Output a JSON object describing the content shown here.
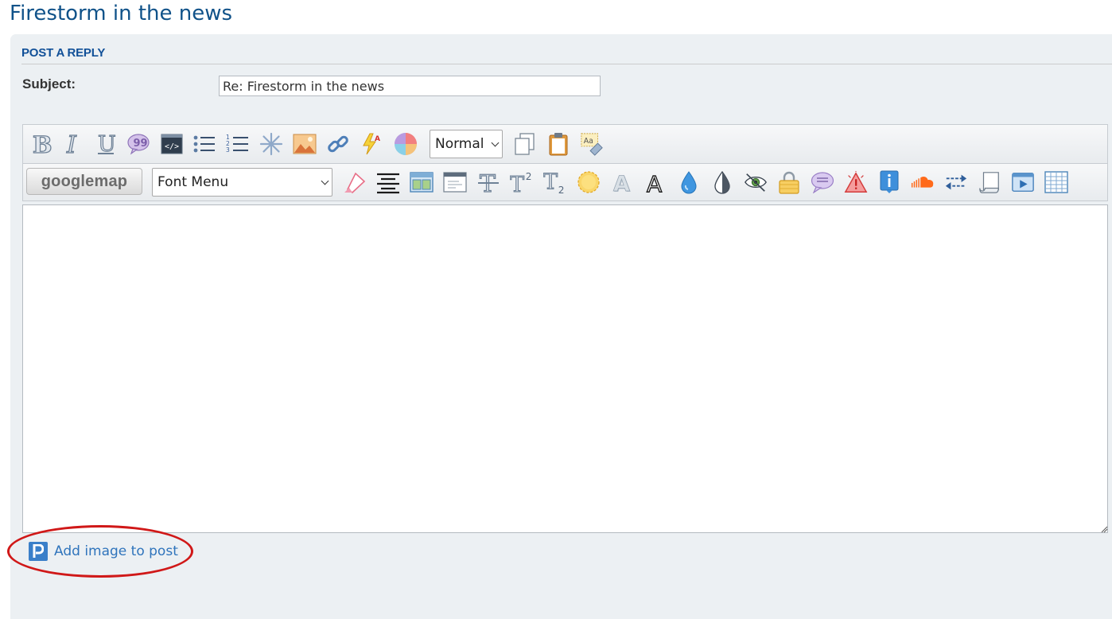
{
  "topic": {
    "title": "Firestorm in the news"
  },
  "reply": {
    "heading": "POST A REPLY",
    "subject_label": "Subject:",
    "subject_value": "Re: Firestorm in the news"
  },
  "toolbar": {
    "row1": {
      "icons": [
        "bold-icon",
        "italic-icon",
        "underline-icon",
        "quote-icon",
        "code-icon",
        "bulleted-list-icon",
        "numbered-list-icon",
        "list-item-icon",
        "image-icon",
        "link-icon",
        "flash-icon",
        "color-wheel-icon"
      ],
      "font_size_value": "Normal",
      "after_icons": [
        "copy-icon",
        "paste-icon",
        "remove-format-icon"
      ]
    },
    "row2": {
      "googlemap_label": "googlemap",
      "font_menu_value": "Font Menu",
      "icons": [
        "highlight-icon",
        "align-center-icon",
        "table-layout-icon",
        "window-icon",
        "strikethrough-icon",
        "superscript-icon",
        "subscript-icon",
        "glow-icon",
        "shadow-text-icon",
        "outline-text-icon",
        "drop-icon",
        "contrast-icon",
        "hidden-eye-icon",
        "lock-icon",
        "speech-bubble-icon",
        "warning-icon",
        "info-icon",
        "soundcloud-icon",
        "swap-icon",
        "scroll-icon",
        "video-icon",
        "grid-table-icon"
      ]
    }
  },
  "editor": {
    "content": ""
  },
  "attach": {
    "label": "Add image to post"
  },
  "colors": {
    "title": "#105289",
    "heading": "#115098",
    "panel_bg": "#ECF0F3",
    "link": "#2F74BC",
    "highlight_ring": "#D01818"
  }
}
